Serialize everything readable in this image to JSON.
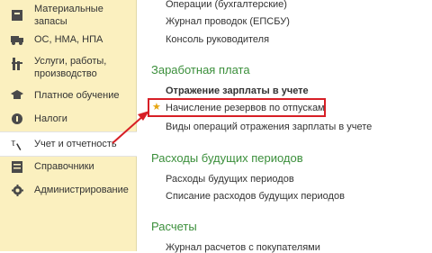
{
  "sidebar": {
    "items": [
      {
        "label": "Материальные запасы",
        "icon": "materials-icon"
      },
      {
        "label": "ОС, НМА, НПА",
        "icon": "truck-icon"
      },
      {
        "label": "Услуги, работы, производство",
        "icon": "services-icon"
      },
      {
        "label": "Платное обучение",
        "icon": "education-icon"
      },
      {
        "label": "Налоги",
        "icon": "taxes-icon"
      },
      {
        "label": "Учет и отчетность",
        "icon": "accounting-icon"
      },
      {
        "label": "Справочники",
        "icon": "catalog-icon"
      },
      {
        "label": "Администрирование",
        "icon": "gear-icon"
      }
    ]
  },
  "main": {
    "top_links": [
      "Операции (бухгалтерские)",
      "Журнал проводок (ЕПСБУ)",
      "Консоль руководителя"
    ],
    "salary": {
      "title": "Заработная плата",
      "links": [
        "Отражение зарплаты в учете",
        "Начисление резервов по отпускам",
        "Виды операций отражения зарплаты в учете"
      ]
    },
    "future_expenses": {
      "title": "Расходы будущих периодов",
      "links": [
        "Расходы будущих периодов",
        "Списание расходов будущих периодов"
      ]
    },
    "settlements": {
      "title": "Расчеты",
      "links": [
        "Журнал расчетов с покупателями"
      ]
    }
  },
  "colors": {
    "sidebar_bg": "#fbf0bf",
    "section_title": "#3b8f3b",
    "highlight": "#d71f26",
    "star": "#e6a50f"
  }
}
